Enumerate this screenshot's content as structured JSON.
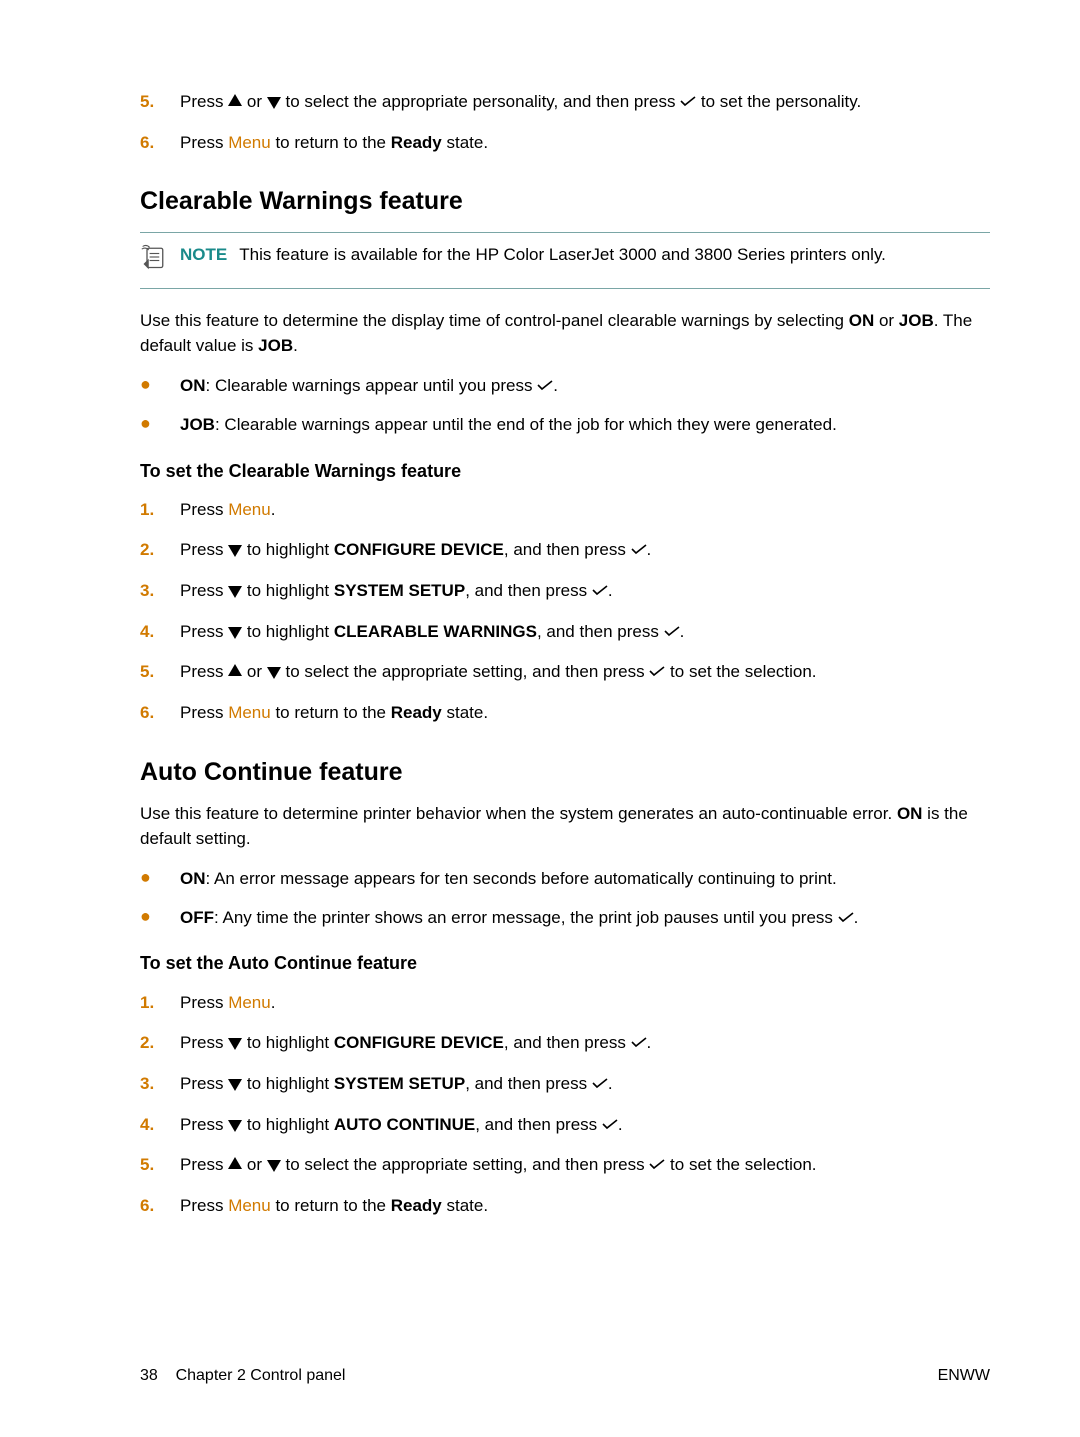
{
  "intro_steps": [
    {
      "n": "5.",
      "pre": "Press ",
      "mid": " or ",
      "post1": " to select the appropriate personality, and then press ",
      "post2": " to set the personality."
    },
    {
      "n": "6.",
      "pre": "Press ",
      "menu": "Menu",
      "post": " to return to the ",
      "bold": "Ready",
      "tail": " state."
    }
  ],
  "clearable": {
    "heading": "Clearable Warnings feature",
    "note_label": "NOTE",
    "note_text": "This feature is available for the HP Color LaserJet 3000 and 3800 Series printers only.",
    "para1a": "Use this feature to determine the display time of control-panel clearable warnings by selecting ",
    "para1b": "ON",
    "para1c": " or ",
    "para1d": "JOB",
    "para1e": ". The default value is ",
    "para1f": "JOB",
    "para1g": ".",
    "bullets": [
      {
        "bold": "ON",
        "text": ": Clearable warnings appear until you press "
      },
      {
        "bold": "JOB",
        "text": ": Clearable warnings appear until the end of the job for which they were generated."
      }
    ],
    "subheading": "To set the Clearable Warnings feature",
    "steps": [
      {
        "n": "1.",
        "pre": "Press ",
        "menu": "Menu",
        "post": "."
      },
      {
        "n": "2.",
        "pre": "Press ",
        "mid": " to highlight ",
        "bold": "CONFIGURE DEVICE",
        "post": ", and then press "
      },
      {
        "n": "3.",
        "pre": "Press ",
        "mid": " to highlight ",
        "bold": "SYSTEM SETUP",
        "post": ", and then press "
      },
      {
        "n": "4.",
        "pre": "Press ",
        "mid": " to highlight ",
        "bold": "CLEARABLE WARNINGS",
        "post": ", and then press "
      },
      {
        "n": "5.",
        "pre": "Press ",
        "mid": " or ",
        "post1": " to select the appropriate setting, and then press ",
        "post2": " to set the selection."
      },
      {
        "n": "6.",
        "pre": "Press ",
        "menu": "Menu",
        "post": " to return to the ",
        "bold": "Ready",
        "tail": " state."
      }
    ]
  },
  "autocontinue": {
    "heading": "Auto Continue feature",
    "para1a": "Use this feature to determine printer behavior when the system generates an auto-continuable error. ",
    "para1b": "ON",
    "para1c": " is the default setting.",
    "bullets": [
      {
        "bold": "ON",
        "text": ": An error message appears for ten seconds before automatically continuing to print."
      },
      {
        "bold": "OFF",
        "text": ": Any time the printer shows an error message, the print job pauses until you press "
      }
    ],
    "subheading": "To set the Auto Continue feature",
    "steps": [
      {
        "n": "1.",
        "pre": "Press ",
        "menu": "Menu",
        "post": "."
      },
      {
        "n": "2.",
        "pre": "Press ",
        "mid": " to highlight ",
        "bold": "CONFIGURE DEVICE",
        "post": ", and then press "
      },
      {
        "n": "3.",
        "pre": "Press ",
        "mid": " to highlight ",
        "bold": "SYSTEM SETUP",
        "post": ", and then press "
      },
      {
        "n": "4.",
        "pre": "Press ",
        "mid": " to highlight ",
        "bold": "AUTO CONTINUE",
        "post": ", and then press "
      },
      {
        "n": "5.",
        "pre": "Press ",
        "mid": " or ",
        "post1": " to select the appropriate setting, and then press ",
        "post2": " to set the selection."
      },
      {
        "n": "6.",
        "pre": "Press ",
        "menu": "Menu",
        "post": " to return to the ",
        "bold": "Ready",
        "tail": " state."
      }
    ]
  },
  "footer": {
    "page": "38",
    "chapter": "Chapter 2   Control panel",
    "right": "ENWW"
  }
}
